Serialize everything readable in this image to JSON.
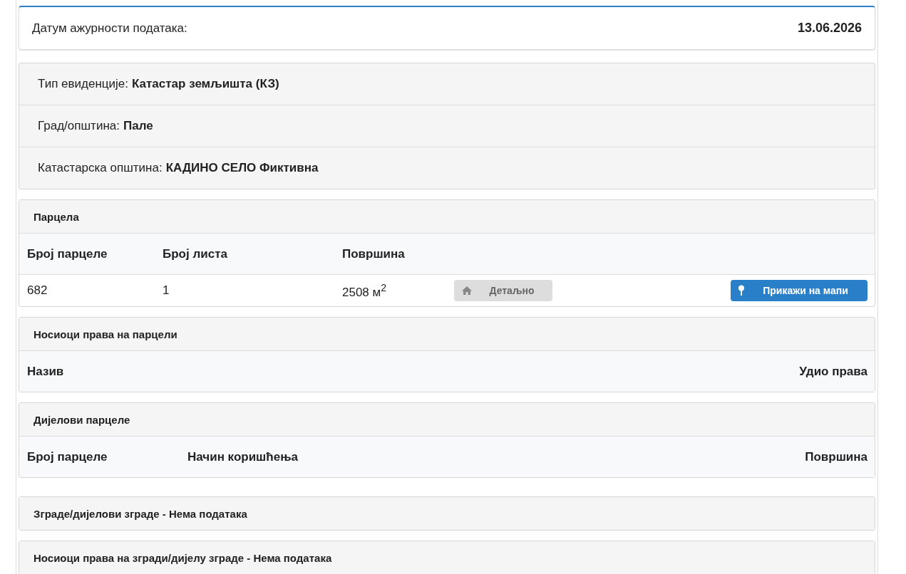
{
  "update_date": {
    "label": "Датум ажурности података:",
    "value": "13.06.2026"
  },
  "info": [
    {
      "label": "Тип евиденције:",
      "value": "Катастар земљишта (КЗ)"
    },
    {
      "label": "Град/општина:",
      "value": "Пале"
    },
    {
      "label": "Катастарска општина:",
      "value": "КАДИНО СЕЛО Фиктивна"
    }
  ],
  "parcel": {
    "title": "Парцела",
    "columns": [
      "Број парцеле",
      "Број листа",
      "Површина"
    ],
    "rows": [
      {
        "cells": [
          "682",
          "1",
          "2508 м$^{2}$"
        ],
        "buttons": [
          {
            "label": "Детаљно",
            "kind": "details",
            "disabled": true
          },
          {
            "label": "Прикажи на мапи",
            "kind": "map",
            "disabled": false
          }
        ]
      }
    ]
  },
  "parcel_holders": {
    "title": "Носиоци права на парцели",
    "columns": [
      "Назив",
      "Удио права"
    ]
  },
  "parcel_parts": {
    "title": "Дијелови парцеле",
    "columns": [
      "Број парцеле",
      "Начин коришћења",
      "Површина"
    ]
  },
  "empty_sections": [
    {
      "title": "Зграде/дијелови зграде - Нема података"
    },
    {
      "title": "Носиоци права на згради/дијелу зграде - Нема података"
    }
  ]
}
